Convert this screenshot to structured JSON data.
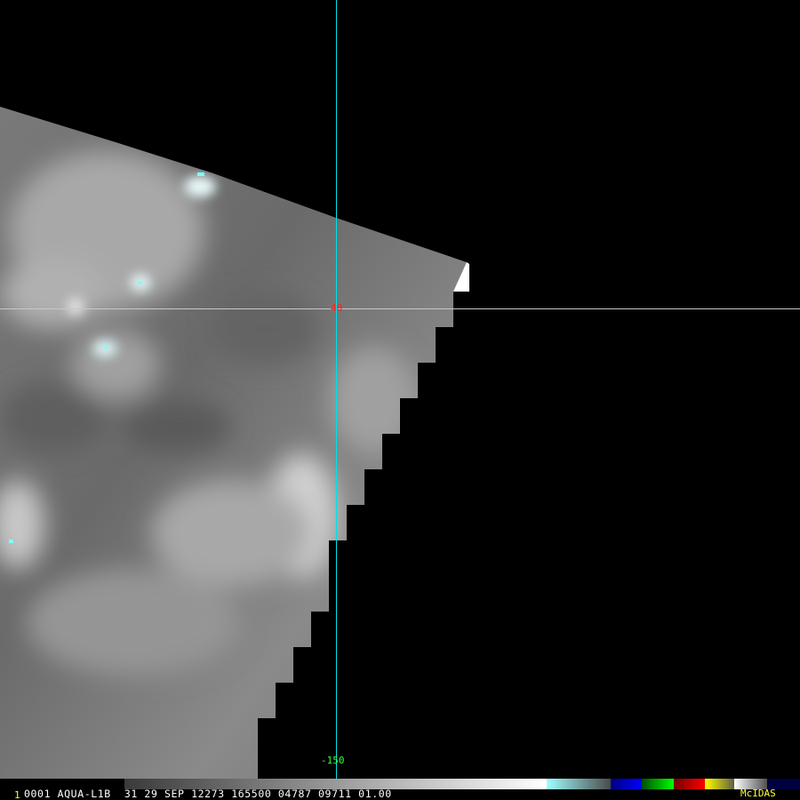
{
  "overlay": {
    "latitude_label": "40",
    "longitude_label": "-150",
    "line_color": "#00e0e8",
    "latitude_label_color": "#ff2020",
    "longitude_label_color": "#30ff30"
  },
  "status_bar": {
    "frame_number": "1",
    "text": "0001 AQUA-L1B  31 29 SEP 12273 165500 04787 09711 01.00",
    "brand": "McIDAS"
  },
  "colorbar": {
    "segments": [
      "#3a3a3a→#ffffff",
      "#a0ffff→#505050",
      "#000080→#0000ff",
      "#006000→#00ff00",
      "#800000→#ff0000",
      "#ffff00→#606040",
      "#ffffff→#505050",
      "#000040"
    ]
  }
}
